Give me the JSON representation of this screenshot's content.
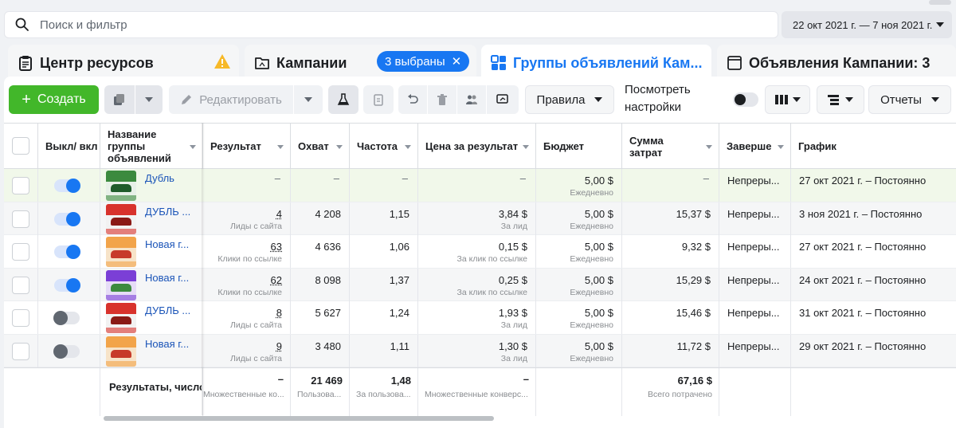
{
  "search": {
    "placeholder": "Поиск и фильтр"
  },
  "date_range": {
    "label": "22 окт 2021 г. — 7 ноя 2021 г."
  },
  "tabs": [
    {
      "label": "Центр ресурсов",
      "icon": "clipboard-icon"
    },
    {
      "label": "Кампании",
      "icon": "folder-icon",
      "badge": "3 выбраны"
    },
    {
      "label": "Группы объявлений Кам...",
      "icon": "grid-icon"
    },
    {
      "label": "Объявления Кампании: 3",
      "icon": "ad-icon"
    }
  ],
  "toolbar": {
    "create_label": "Создать",
    "edit_label": "Редактировать",
    "rules_label": "Правила",
    "settings_label": "Посмотреть настройки",
    "reports_label": "Отчеты"
  },
  "columns": {
    "onoff": "Выкл/ вкл",
    "name": "Название группы объявлений",
    "result": "Результат",
    "reach": "Охват",
    "frequency": "Частота",
    "cost_per_result": "Цена за результат",
    "budget": "Бюджет",
    "spent": "Сумма затрат",
    "ends": "Заверше",
    "schedule": "График"
  },
  "rows": [
    {
      "name": "Дубль",
      "on": true,
      "thumb": "green",
      "result": "–",
      "result_sub": "",
      "reach": "–",
      "frequency": "–",
      "cpr": "–",
      "cpr_sub": "",
      "budget": "5,00 $",
      "budget_sub": "Ежедневно",
      "spent": "–",
      "ends": "Непреры...",
      "schedule": "27 окт 2021 г. – Постоянно"
    },
    {
      "name": "ДУБЛЬ ...",
      "on": true,
      "thumb": "red",
      "result": "4",
      "result_sub": "Лиды с сайта",
      "reach": "4 208",
      "frequency": "1,15",
      "cpr": "3,84 $",
      "cpr_sub": "За лид",
      "budget": "5,00 $",
      "budget_sub": "Ежедневно",
      "spent": "15,37 $",
      "ends": "Непреры...",
      "schedule": "3 ноя 2021 г. – Постоянно"
    },
    {
      "name": "Новая г...",
      "on": true,
      "thumb": "orange",
      "result": "63",
      "result_sub": "Клики по ссылке",
      "reach": "4 636",
      "frequency": "1,06",
      "cpr": "0,15 $",
      "cpr_sub": "За клик по ссылке",
      "budget": "5,00 $",
      "budget_sub": "Ежедневно",
      "spent": "9,32 $",
      "ends": "Непреры...",
      "schedule": "27 окт 2021 г. – Постоянно"
    },
    {
      "name": "Новая г...",
      "on": true,
      "thumb": "purple",
      "result": "62",
      "result_sub": "Клики по ссылке",
      "reach": "8 098",
      "frequency": "1,37",
      "cpr": "0,25 $",
      "cpr_sub": "За клик по ссылке",
      "budget": "5,00 $",
      "budget_sub": "Ежедневно",
      "spent": "15,29 $",
      "ends": "Непреры...",
      "schedule": "24 окт 2021 г. – Постоянно"
    },
    {
      "name": "ДУБЛЬ ...",
      "on": false,
      "thumb": "red",
      "result": "8",
      "result_sub": "Лиды с сайта",
      "reach": "5 627",
      "frequency": "1,24",
      "cpr": "1,93 $",
      "cpr_sub": "За лид",
      "budget": "5,00 $",
      "budget_sub": "Ежедневно",
      "spent": "15,46 $",
      "ends": "Непреры...",
      "schedule": "31 окт 2021 г. – Постоянно"
    },
    {
      "name": "Новая г...",
      "on": false,
      "thumb": "orange",
      "result": "9",
      "result_sub": "Лиды с сайта",
      "reach": "3 480",
      "frequency": "1,11",
      "cpr": "1,30 $",
      "cpr_sub": "За лид",
      "budget": "5,00 $",
      "budget_sub": "Ежедневно",
      "spent": "11,72 $",
      "ends": "Непреры...",
      "schedule": "29 окт 2021 г. – Постоянно"
    }
  ],
  "totals": {
    "label": "Результаты, число",
    "result": "–",
    "result_sub": "Множественные ко...",
    "reach": "21 469",
    "reach_sub": "Пользова...",
    "frequency": "1,48",
    "frequency_sub": "За пользова...",
    "cpr": "–",
    "cpr_sub": "Множественные конверс...",
    "spent": "67,16 $",
    "spent_sub": "Всего потрачено"
  },
  "colors": {
    "accent": "#1877f2",
    "create": "#42b72a",
    "warning": "#f7b928"
  }
}
